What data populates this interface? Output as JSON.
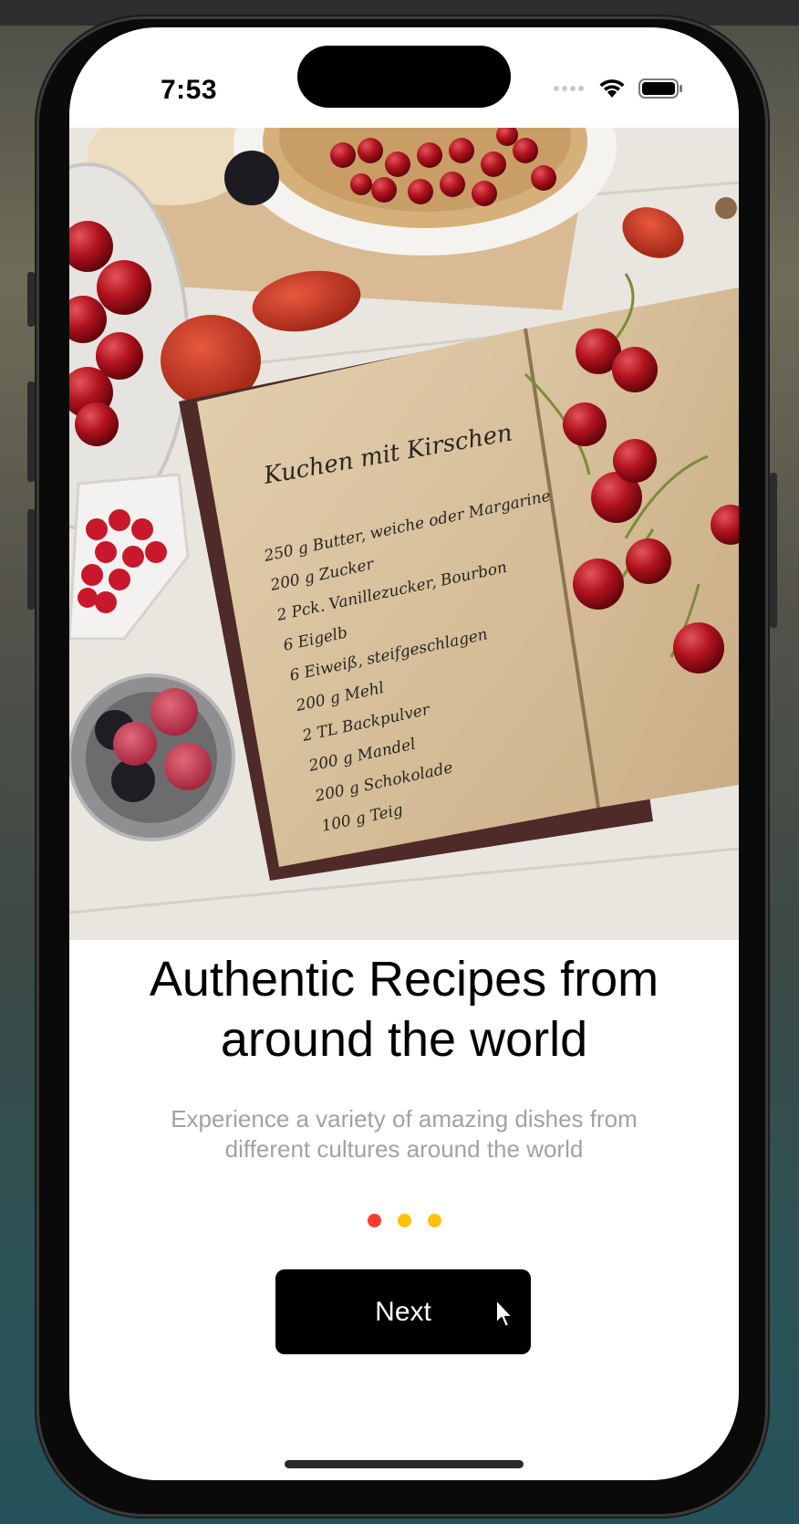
{
  "status_bar": {
    "time": "7:53"
  },
  "hero_image": {
    "recipe_title": "Kuchen mit Kirschen",
    "recipe_lines": [
      "250 g Butter, weiche oder Margarine",
      "200 g Zucker",
      "2 Pck. Vanillezucker, Bourbon",
      "6 Eigelb",
      "6 Eiweiß, steifgeschlagen",
      "200 g Mehl",
      "2 TL Backpulver",
      "200 g Mandel",
      "200 g Schokolade",
      "100 g Teig"
    ]
  },
  "onboarding": {
    "title_line1": "Authentic Recipes from",
    "title_line2": "around the world",
    "subtitle_line1": "Experience a variety of amazing dishes from",
    "subtitle_line2": "different cultures around the world",
    "page_indicator": {
      "count": 3,
      "active_index": 0,
      "active_color": "#ff3b30",
      "inactive_color": "#ffc107"
    },
    "next_label": "Next"
  },
  "icons": {
    "signal": "cellular-signal-icon",
    "wifi": "wifi-icon",
    "battery": "battery-icon",
    "cursor": "mouse-pointer-icon"
  }
}
